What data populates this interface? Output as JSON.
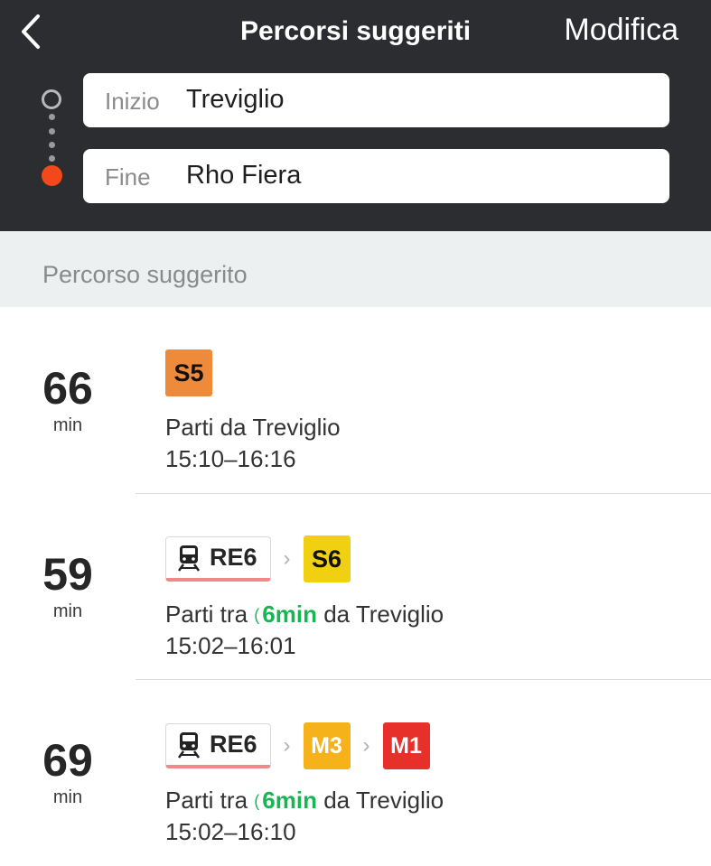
{
  "header": {
    "title": "Percorsi suggeriti",
    "edit_label": "Modifica",
    "start_label": "Inizio",
    "start_value": "Treviglio",
    "end_label": "Fine",
    "end_value": "Rho Fiera"
  },
  "section_label": "Percorso suggerito",
  "colors": {
    "header_bg": "#2c2d30",
    "accent_orange": "#f2481b",
    "live_green": "#19b554",
    "s5": "#ef8a3a",
    "s6": "#f0d010",
    "m3": "#f5b21b",
    "m1": "#e8302a"
  },
  "routes": [
    {
      "duration": "66",
      "unit": "min",
      "lines": [
        {
          "label": "S5"
        }
      ],
      "depart_text": "Parti da Treviglio",
      "times": "15:10–16:16"
    },
    {
      "duration": "59",
      "unit": "min",
      "lines": [
        {
          "label": "RE6"
        },
        {
          "label": "S6"
        }
      ],
      "depart_prefix": "Parti tra",
      "depart_live": "6min",
      "depart_suffix": "da Treviglio",
      "times": "15:02–16:01"
    },
    {
      "duration": "69",
      "unit": "min",
      "lines": [
        {
          "label": "RE6"
        },
        {
          "label": "M3"
        },
        {
          "label": "M1"
        }
      ],
      "depart_prefix": "Parti tra",
      "depart_live": "6min",
      "depart_suffix": "da Treviglio",
      "times": "15:02–16:10"
    }
  ]
}
